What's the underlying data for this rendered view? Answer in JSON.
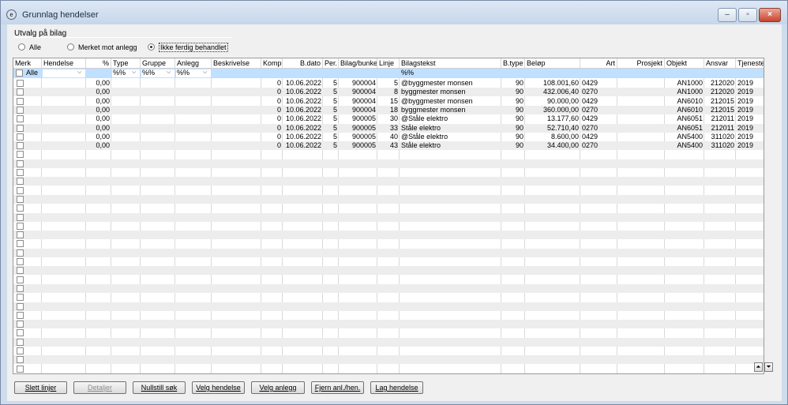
{
  "window": {
    "title": "Grunnlag hendelser"
  },
  "selection": {
    "label": "Utvalg på bilag",
    "options": [
      "Alle",
      "Merket mot anlegg",
      "Ikke ferdig behandlet"
    ],
    "selected_index": 2
  },
  "columns": [
    "Merk",
    "Hendelse",
    "%",
    "Type",
    "Gruppe",
    "Anlegg",
    "Beskrivelse",
    "Komp",
    "B.dato",
    "Per.",
    "Bilag/bunke",
    "Linje",
    "Bilagstekst",
    "B.type",
    "Beløp",
    "Art",
    "Prosjekt",
    "Objekt",
    "Ansvar",
    "Tjeneste"
  ],
  "filters": {
    "merk": "Alle",
    "type": "%%",
    "gruppe": "%%",
    "anlegg": "%%",
    "bilagstekst": "%%"
  },
  "rows": [
    {
      "pct": "0,00",
      "komp": "0",
      "bdato": "10.06.2022",
      "per": "5",
      "bilag": "900004",
      "linje": "5",
      "tekst": "@byggmester monsen",
      "btype": "90",
      "belop": "108.001,60",
      "art": "0429",
      "objekt": "AN1000",
      "ansvar": "212020",
      "tjeneste": "2019"
    },
    {
      "pct": "0,00",
      "komp": "0",
      "bdato": "10.06.2022",
      "per": "5",
      "bilag": "900004",
      "linje": "8",
      "tekst": "byggmester monsen",
      "btype": "90",
      "belop": "432.006,40",
      "art": "0270",
      "objekt": "AN1000",
      "ansvar": "212020",
      "tjeneste": "2019"
    },
    {
      "pct": "0,00",
      "komp": "0",
      "bdato": "10.06.2022",
      "per": "5",
      "bilag": "900004",
      "linje": "15",
      "tekst": "@byggmester monsen",
      "btype": "90",
      "belop": "90.000,00",
      "art": "0429",
      "objekt": "AN6010",
      "ansvar": "212015",
      "tjeneste": "2019"
    },
    {
      "pct": "0,00",
      "komp": "0",
      "bdato": "10.06.2022",
      "per": "5",
      "bilag": "900004",
      "linje": "18",
      "tekst": "byggmester monsen",
      "btype": "90",
      "belop": "360.000,00",
      "art": "0270",
      "objekt": "AN6010",
      "ansvar": "212015",
      "tjeneste": "2019"
    },
    {
      "pct": "0,00",
      "komp": "0",
      "bdato": "10.06.2022",
      "per": "5",
      "bilag": "900005",
      "linje": "30",
      "tekst": "@Ståle elektro",
      "btype": "90",
      "belop": "13.177,60",
      "art": "0429",
      "objekt": "AN6051",
      "ansvar": "212011",
      "tjeneste": "2019"
    },
    {
      "pct": "0,00",
      "komp": "0",
      "bdato": "10.06.2022",
      "per": "5",
      "bilag": "900005",
      "linje": "33",
      "tekst": "Ståle elektro",
      "btype": "90",
      "belop": "52.710,40",
      "art": "0270",
      "objekt": "AN6051",
      "ansvar": "212011",
      "tjeneste": "2019"
    },
    {
      "pct": "0,00",
      "komp": "0",
      "bdato": "10.06.2022",
      "per": "5",
      "bilag": "900005",
      "linje": "40",
      "tekst": "@Ståle elektro",
      "btype": "90",
      "belop": "8.600,00",
      "art": "0429",
      "objekt": "AN5400",
      "ansvar": "311020",
      "tjeneste": "2019"
    },
    {
      "pct": "0,00",
      "komp": "0",
      "bdato": "10.06.2022",
      "per": "5",
      "bilag": "900005",
      "linje": "43",
      "tekst": "Ståle elektro",
      "btype": "90",
      "belop": "34.400,00",
      "art": "0270",
      "objekt": "AN5400",
      "ansvar": "311020",
      "tjeneste": "2019"
    }
  ],
  "buttons": [
    "Slett linjer",
    "Detaljer",
    "Nullstill søk",
    "Velg hendelse",
    "Velg anlegg",
    "Fjern anl./hen.",
    "Lag hendelse"
  ],
  "disabled_buttons": [
    "Detaljer"
  ],
  "icons": {
    "app": "app-logo-icon",
    "minimize": "minimize-icon",
    "maximize": "maximize-icon",
    "close": "close-icon",
    "scroll_up": "scroll-up-icon",
    "scroll_down": "scroll-down-icon",
    "dropdown": "chevron-down-icon"
  },
  "colors": {
    "filter_row": "#bfe0ff",
    "alt_row": "#ededed",
    "window_frame": "#cfdcec",
    "close_button": "#c9432c"
  }
}
